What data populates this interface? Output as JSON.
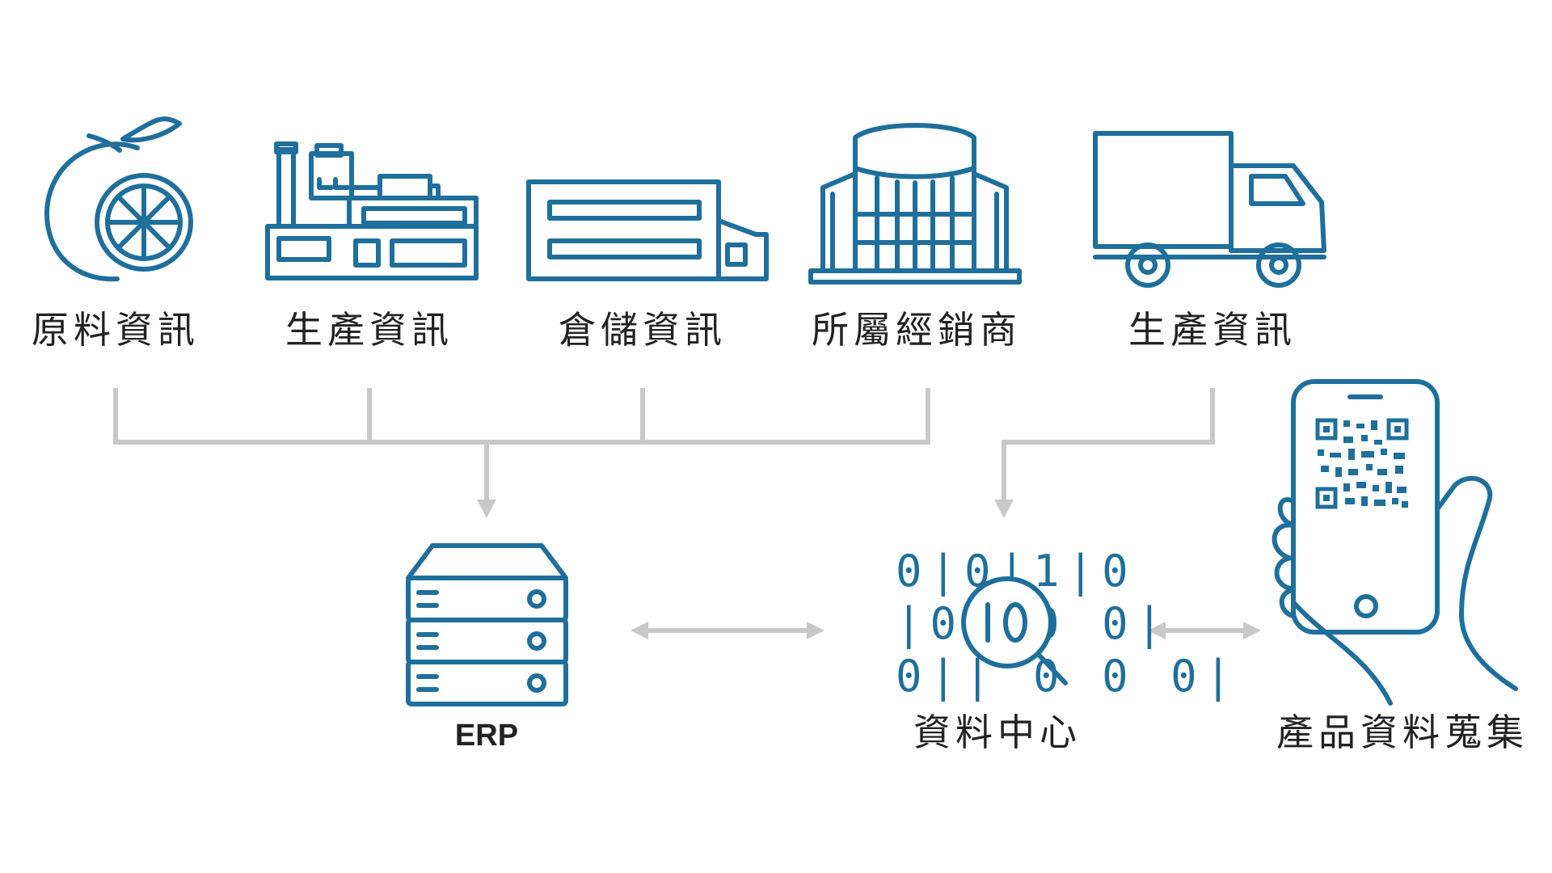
{
  "sources": [
    {
      "label": "原料資訊",
      "icon": "orange-fruit-icon"
    },
    {
      "label": "生產資訊",
      "icon": "factory-icon"
    },
    {
      "label": "倉儲資訊",
      "icon": "warehouse-icon"
    },
    {
      "label": "所屬經銷商",
      "icon": "distributor-building-icon"
    },
    {
      "label": "生產資訊",
      "icon": "delivery-truck-icon"
    }
  ],
  "hubs": {
    "erp": {
      "label": "ERP",
      "icon": "server-icon"
    },
    "data_center": {
      "label": "資料中心",
      "icon": "binary-search-icon",
      "bit_rows": [
        "0|0|1|0",
        "|0 |0 0|",
        "0|| 0 0 0|"
      ]
    },
    "product_collection": {
      "label": "產品資料蒐集",
      "icon": "phone-qr-scan-icon"
    }
  },
  "colors": {
    "icon": "#1f6f9c",
    "connector": "#c8c8c8",
    "text": "#222222"
  }
}
